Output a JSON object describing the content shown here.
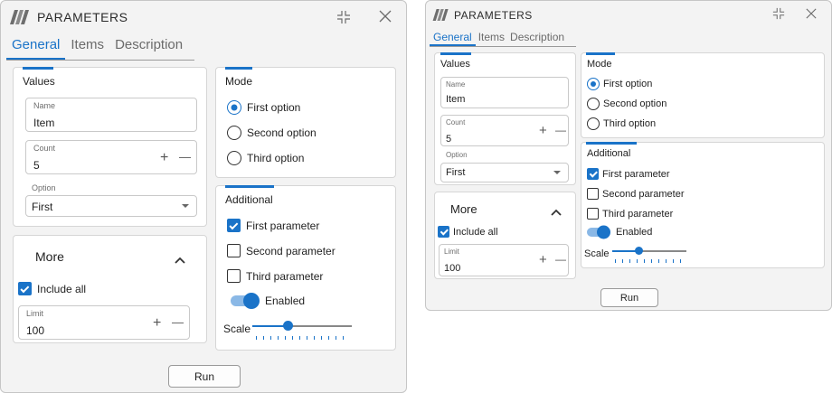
{
  "windows": [
    {
      "title": "PARAMETERS",
      "tabs": [
        {
          "label": "General"
        },
        {
          "label": "Items"
        },
        {
          "label": "Description"
        }
      ],
      "values": {
        "title": "Values",
        "name": {
          "label": "Name",
          "value": "Item"
        },
        "count": {
          "label": "Count",
          "value": "5"
        },
        "option": {
          "label": "Option",
          "value": "First"
        }
      },
      "more": {
        "title": "More",
        "include_all": "Include all",
        "limit": {
          "label": "Limit",
          "value": "100"
        }
      },
      "mode": {
        "title": "Mode",
        "options": [
          {
            "label": "First option"
          },
          {
            "label": "Second option"
          },
          {
            "label": "Third option"
          }
        ]
      },
      "additional": {
        "title": "Additional",
        "params": [
          {
            "label": "First parameter"
          },
          {
            "label": "Second parameter"
          },
          {
            "label": "Third parameter"
          }
        ],
        "toggle": "Enabled",
        "scale": "Scale"
      },
      "run": "Run",
      "icons": {
        "plus": "+",
        "minus": "—"
      }
    },
    {
      "title": "PARAMETERS",
      "tabs": [
        {
          "label": "General"
        },
        {
          "label": "Items"
        },
        {
          "label": "Description"
        }
      ],
      "values": {
        "title": "Values",
        "name": {
          "label": "Name",
          "value": "Item"
        },
        "count": {
          "label": "Count",
          "value": "5"
        },
        "option": {
          "label": "Option",
          "value": "First"
        }
      },
      "more": {
        "title": "More",
        "include_all": "Include all",
        "limit": {
          "label": "Limit",
          "value": "100"
        }
      },
      "mode": {
        "title": "Mode",
        "options": [
          {
            "label": "First option"
          },
          {
            "label": "Second option"
          },
          {
            "label": "Third option"
          }
        ]
      },
      "additional": {
        "title": "Additional",
        "params": [
          {
            "label": "First parameter"
          },
          {
            "label": "Second parameter"
          },
          {
            "label": "Third parameter"
          }
        ],
        "toggle": "Enabled",
        "scale": "Scale"
      },
      "run": "Run",
      "icons": {
        "plus": "+",
        "minus": "—"
      }
    }
  ],
  "state": {
    "selected_mode": "First option",
    "first_parameter_checked": true,
    "include_all_checked": true,
    "enabled_on": true,
    "scale_fraction": 0.35
  },
  "colors": {
    "accent": "#1a73c8",
    "window_bg": "#f3f3f3",
    "group_bg": "#ffffff"
  }
}
